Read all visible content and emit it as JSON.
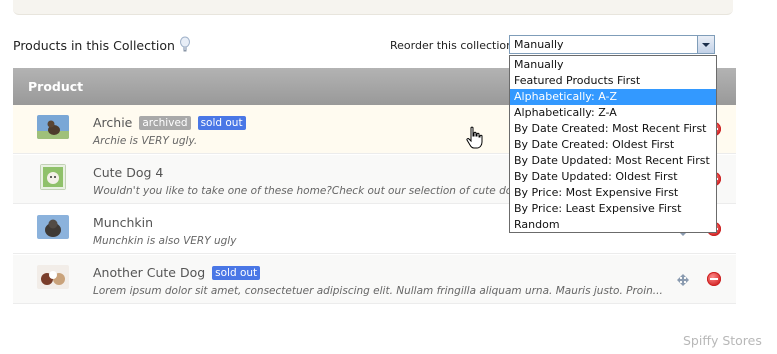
{
  "toolbar": {
    "title": "Products in this Collection",
    "reorder_label": "Reorder this collection",
    "selected_order": "Manually"
  },
  "reorder_options": [
    "Manually",
    "Featured Products First",
    "Alphabetically: A-Z",
    "Alphabetically: Z-A",
    "By Date Created: Most Recent First",
    "By Date Created: Oldest First",
    "By Date Updated: Most Recent First",
    "By Date Updated: Oldest First",
    "By Price: Most Expensive First",
    "By Price: Least Expensive First",
    "Random"
  ],
  "highlighted_option": "Alphabetically: A-Z",
  "table": {
    "header": "Product",
    "rows": [
      {
        "name": "Archie",
        "badges": [
          "archived",
          "sold out"
        ],
        "description": "Archie is VERY ugly."
      },
      {
        "name": "Cute Dog 4",
        "badges": [],
        "description": "Wouldn't you like to take one of these home?Check out our selection of cute dogs."
      },
      {
        "name": "Munchkin",
        "badges": [],
        "description": "Munchkin is also VERY ugly"
      },
      {
        "name": "Another Cute Dog",
        "badges": [
          "sold out"
        ],
        "description": "Lorem ipsum dolor sit amet, consectetuer adipiscing elit. Nullam fringilla aliquam urna. Mauris justo. Proin..."
      }
    ]
  },
  "watermark": "Spiffy Stores",
  "icons": {
    "hint": "lightbulb-icon",
    "move": "move-arrows-icon",
    "remove": "remove-circle-icon",
    "cursor": "hand-pointer-icon"
  },
  "colors": {
    "sold_out_badge": "#4a77e6",
    "archived_badge": "#a9a9a9",
    "header_bg": "#a6a6a6",
    "selected_option": "#3399ff",
    "remove_icon": "#d42a2a"
  }
}
